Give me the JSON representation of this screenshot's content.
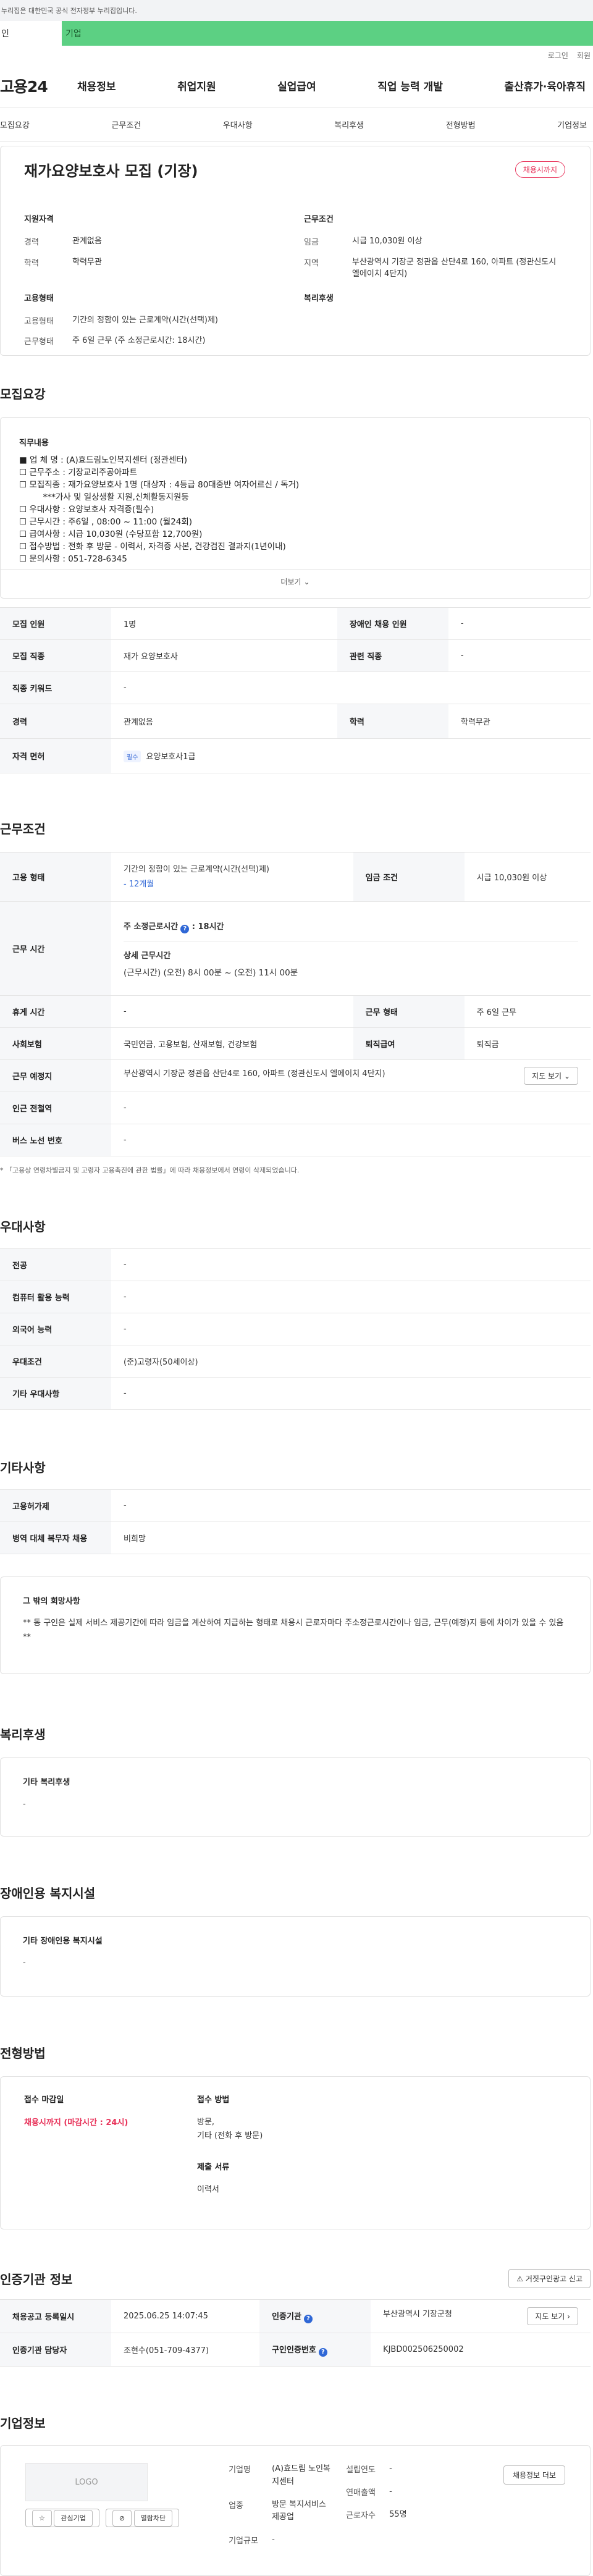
{
  "gov_notice": "누리집은 대한민국 공식 전자정부 누리집입니다.",
  "top_tabs": [
    "인",
    "기업"
  ],
  "util_links": [
    "로그인",
    "회원"
  ],
  "logo": "고용24",
  "gnb": [
    "채용정보",
    "취업지원",
    "실업급여",
    "직업 능력 개발",
    "출산휴가·육아휴직"
  ],
  "anchor_tabs": [
    "모집요강",
    "근무조건",
    "우대사항",
    "복리후생",
    "전형방법",
    "기업정보"
  ],
  "summary": {
    "title": "재가요양보호사 모집 (기장)",
    "badge": "채용시까지",
    "qualification": {
      "title": "지원자격",
      "career_label": "경력",
      "career": "관계없음",
      "edu_label": "학력",
      "edu": "학력무관"
    },
    "conditions": {
      "title": "근무조건",
      "wage_label": "임금",
      "wage": "시급 10,030원 이상",
      "region_label": "지역",
      "region": "부산광역시 기장군 정관읍 산단4로 160, 아파트 (정관신도시 엘에이치 4단지)"
    },
    "employment": {
      "title": "고용형태",
      "type_label": "고용형태",
      "type": "기간의 정함이 있는 근로계약(시간(선택)제)",
      "work_label": "근무형태",
      "work": "주 6일 근무 (주 소정근로시간: 18시간)"
    },
    "welfare_title": "복리후생"
  },
  "recruit": {
    "title": "모집요강",
    "desc_title": "직무내용",
    "lines": [
      "■ 업 체 명 : (A)효드림노인복지센터 (정관센터)",
      "☐ 근무주소 : 기장교리주공아파트",
      "☐ 모집직종 : 재가요양보호사 1명 (대상자 : 4등급 80대중반 여자어르신 / 독거)",
      "         ***가사 및 일상생활 지원,신체활동지원등",
      "☐ 우대사항 : 요양보호사 자격증(필수)",
      "☐ 근무시간 : 주6일 , 08:00 ~ 11:00 (월24회)",
      "☐ 급여사항 : 시급 10,030원 (수당포함 12,700원)",
      "☐ 접수방법 : 전화 후 방문 - 이력서, 자격증 사본, 건강검진 결과지(1년이내)",
      "☐ 문의사항 : 051-728-6345"
    ],
    "more": "더보기",
    "table": {
      "count_label": "모집 인원",
      "count": "1명",
      "disabled_label": "장애인 채용 인원",
      "disabled": "-",
      "job_label": "모집 직종",
      "job": "재가 요양보호사",
      "related_label": "관련 직종",
      "related": "-",
      "keyword_label": "직종 키워드",
      "keyword": "-",
      "career_label": "경력",
      "career": "관계없음",
      "edu_label": "학력",
      "edu": "학력무관",
      "license_label": "자격 면허",
      "license_chip": "필수",
      "license": "요양보호사1급"
    }
  },
  "work": {
    "title": "근무조건",
    "type_label": "고용 형태",
    "type": "기간의 정함이 있는 근로계약(시간(선택)제)",
    "type_period": "- 12개월",
    "wage_label": "임금 조건",
    "wage": "시급 10,030원 이상",
    "time_label": "근무 시간",
    "weekly": "주 소정근로시간",
    "weekly_hours": ": 18시간",
    "detail_title": "상세 근무시간",
    "detail": "(근무시간) (오전) 8시 00분 ~ (오전) 11시 00분",
    "break_label": "휴게 시간",
    "break": "-",
    "form_label": "근무 형태",
    "form": "주 6일 근무",
    "insurance_label": "사회보험",
    "insurance": "국민연금, 고용보험, 산재보험, 건강보험",
    "severance_label": "퇴직급여",
    "severance": "퇴직금",
    "place_label": "근무 예정지",
    "place": "부산광역시 기장군 정관읍 산단4로 160, 아파트 (정관신도시 엘에이치 4단지)",
    "map": "지도 보기",
    "subway_label": "인근 전철역",
    "subway": "-",
    "bus_label": "버스 노선 번호",
    "bus": "-",
    "note": "* 「고용상 연령차별금지 및 고령자 고용촉진에 관한 법률」에 따라 채용정보에서 연령이 삭제되었습니다."
  },
  "preference": {
    "title": "우대사항",
    "major_label": "전공",
    "major": "-",
    "computer_label": "컴퓨터 활용 능력",
    "computer": "-",
    "language_label": "외국어 능력",
    "language": "-",
    "cond_label": "우대조건",
    "cond": "(준)고령자(50세이상)",
    "etc_label": "기타 우대사항",
    "etc": "-"
  },
  "other": {
    "title": "기타사항",
    "disabled_label": "고용허가제",
    "disabled": "-",
    "military_label": "병역 대체 복무자 채용",
    "military": "비희망",
    "wish_title": "그 밖의 희망사항",
    "wish": "** 동 구인은 실제 서비스 제공기간에 따라 임금을 계산하여 지급하는 형태로 채용시 근로자마다 주소정근로시간이나 임금, 근무(예정)지 등에 차이가 있을 수 있음 **"
  },
  "welfare": {
    "title": "복리후생",
    "card_title": "기타 복리후생",
    "value": "-"
  },
  "facility": {
    "title": "장애인용 복지시설",
    "card_title": "기타 장애인용 복지시설",
    "value": "-"
  },
  "method": {
    "title": "전형방법",
    "deadline_title": "접수 마감일",
    "deadline": "채용시까지 (마감시간 : 24시)",
    "how_title": "접수 방법",
    "how": "방문,",
    "how2": "기타 (전화 후 방문)",
    "docs_title": "제출 서류",
    "docs": "이력서"
  },
  "cert": {
    "title": "인증기관 정보",
    "report": "거짓구인광고 신고",
    "date_label": "채용공고 등록일시",
    "date": "2025.06.25 14:07:45",
    "org_label": "인증기관",
    "org": "부산광역시 기장군청",
    "detail": "지도 보기",
    "manager_label": "인증기관 담당자",
    "manager": "조현수(051-709-4377)",
    "num_label": "구인인증번호",
    "num": "KJBD002506250002"
  },
  "company": {
    "title": "기업정보",
    "logo": "LOGO",
    "interest": "관심기업",
    "block": "열람차단",
    "name_label": "기업명",
    "name": "(A)효드림 노인복지센터",
    "found_label": "설립연도",
    "found": "-",
    "sales_label": "연매출액",
    "sales": "-",
    "industry_label": "업종",
    "industry": "방문 복지서비스 제공업",
    "employees_label": "근로자수",
    "employees": "55명",
    "size_label": "기업규모",
    "size": "-",
    "more": "채용정보 더보"
  }
}
